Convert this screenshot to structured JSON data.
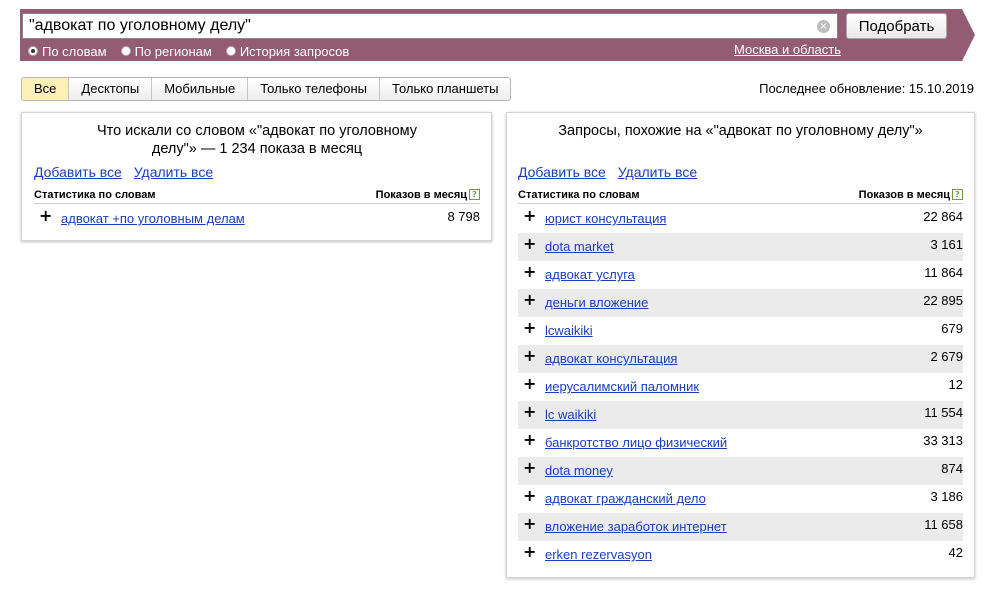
{
  "search": {
    "query": "\"адвокат по уголовному делу\"",
    "button_label": "Подобрать",
    "radios": [
      {
        "label": "По словам",
        "checked": true
      },
      {
        "label": "По регионам",
        "checked": false
      },
      {
        "label": "История запросов",
        "checked": false
      }
    ],
    "region": "Москва и область"
  },
  "tabs": [
    {
      "label": "Все",
      "active": true
    },
    {
      "label": "Десктопы",
      "active": false
    },
    {
      "label": "Мобильные",
      "active": false
    },
    {
      "label": "Только телефоны",
      "active": false
    },
    {
      "label": "Только планшеты",
      "active": false
    }
  ],
  "last_update": "Последнее обновление: 15.10.2019",
  "left_panel": {
    "title_line1": "Что искали со словом «\"адвокат по уголовному",
    "title_line2": "делу\"» — 1 234 показа в месяц",
    "add_all": "Добавить все",
    "remove_all": "Удалить все",
    "col_words": "Статистика по словам",
    "col_count": "Показов в месяц",
    "help_icon": "?",
    "rows": [
      {
        "keyword": "адвокат +по уголовным делам",
        "count": "8 798"
      }
    ]
  },
  "right_panel": {
    "title": "Запросы, похожие на «\"адвокат по уголовному делу\"»",
    "add_all": "Добавить все",
    "remove_all": "Удалить все",
    "col_words": "Статистика по словам",
    "col_count": "Показов в месяц",
    "help_icon": "?",
    "rows": [
      {
        "keyword": "юрист консультация",
        "count": "22 864"
      },
      {
        "keyword": "dota market",
        "count": "3 161"
      },
      {
        "keyword": "адвокат услуга",
        "count": "11 864"
      },
      {
        "keyword": "деньги вложение",
        "count": "22 895"
      },
      {
        "keyword": "lcwaikiki",
        "count": "679"
      },
      {
        "keyword": "адвокат консультация",
        "count": "2 679"
      },
      {
        "keyword": "иерусалимский паломник",
        "count": "12"
      },
      {
        "keyword": "lc waikiki",
        "count": "11 554"
      },
      {
        "keyword": "банкротство лицо физический",
        "count": "33 313"
      },
      {
        "keyword": "dota money",
        "count": "874"
      },
      {
        "keyword": "адвокат гражданский дело",
        "count": "3 186"
      },
      {
        "keyword": "вложение заработок интернет",
        "count": "11 658"
      },
      {
        "keyword": "erken rezervasyon",
        "count": "42"
      }
    ]
  },
  "colors": {
    "topbar": "#935c73",
    "active_tab": "#fcefb8",
    "link": "#1a3dc1",
    "row_shade": "#ebebeb"
  },
  "icons": {
    "clear": "clear-icon",
    "help": "help-icon",
    "add": "plus-icon"
  }
}
